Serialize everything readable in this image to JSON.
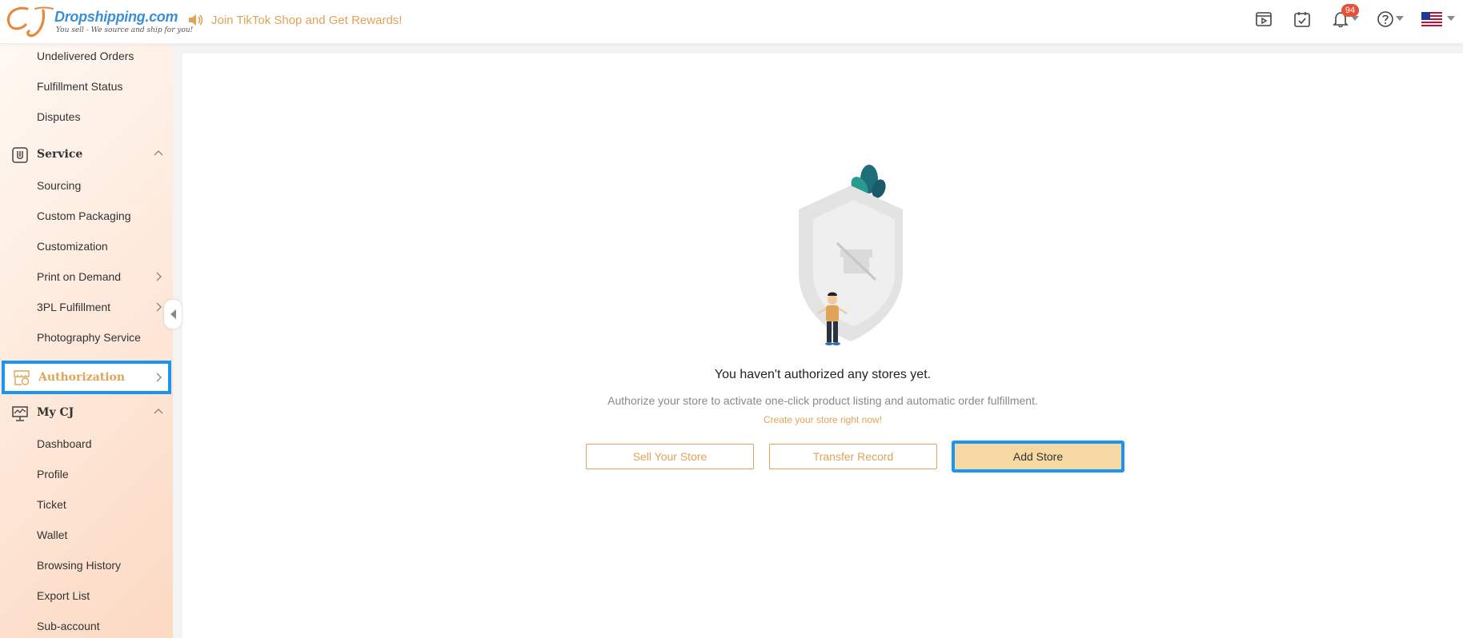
{
  "header": {
    "logo_text": "Dropshipping.com",
    "logo_tagline": "You sell - We source and ship for you!",
    "promo_text": "Join TikTok Shop and Get Rewards!",
    "notification_count": "94"
  },
  "sidebar": {
    "items_top": [
      {
        "label": "Undelivered Orders"
      },
      {
        "label": "Fulfillment Status"
      },
      {
        "label": "Disputes"
      }
    ],
    "service": {
      "label": "Service",
      "items": [
        {
          "label": "Sourcing"
        },
        {
          "label": "Custom Packaging"
        },
        {
          "label": "Customization"
        },
        {
          "label": "Print on Demand"
        },
        {
          "label": "3PL Fulfillment"
        },
        {
          "label": "Photography Service"
        }
      ]
    },
    "authorization": {
      "label": "Authorization"
    },
    "mycj": {
      "label": "My CJ",
      "items": [
        {
          "label": "Dashboard"
        },
        {
          "label": "Profile"
        },
        {
          "label": "Ticket"
        },
        {
          "label": "Wallet"
        },
        {
          "label": "Browsing History"
        },
        {
          "label": "Export List"
        },
        {
          "label": "Sub-account"
        }
      ]
    }
  },
  "main": {
    "empty_title": "You haven't authorized any stores yet.",
    "empty_description": "Authorize your store to activate one-click product listing and automatic order fulfillment.",
    "create_link": "Create your store right now!",
    "buttons": {
      "sell_store": "Sell Your Store",
      "transfer_record": "Transfer Record",
      "add_store": "Add Store"
    }
  },
  "colors": {
    "accent": "#e0a35a",
    "highlight": "#1a95f2",
    "primary_button_bg": "#f6d8a3",
    "badge": "#e8503a"
  }
}
